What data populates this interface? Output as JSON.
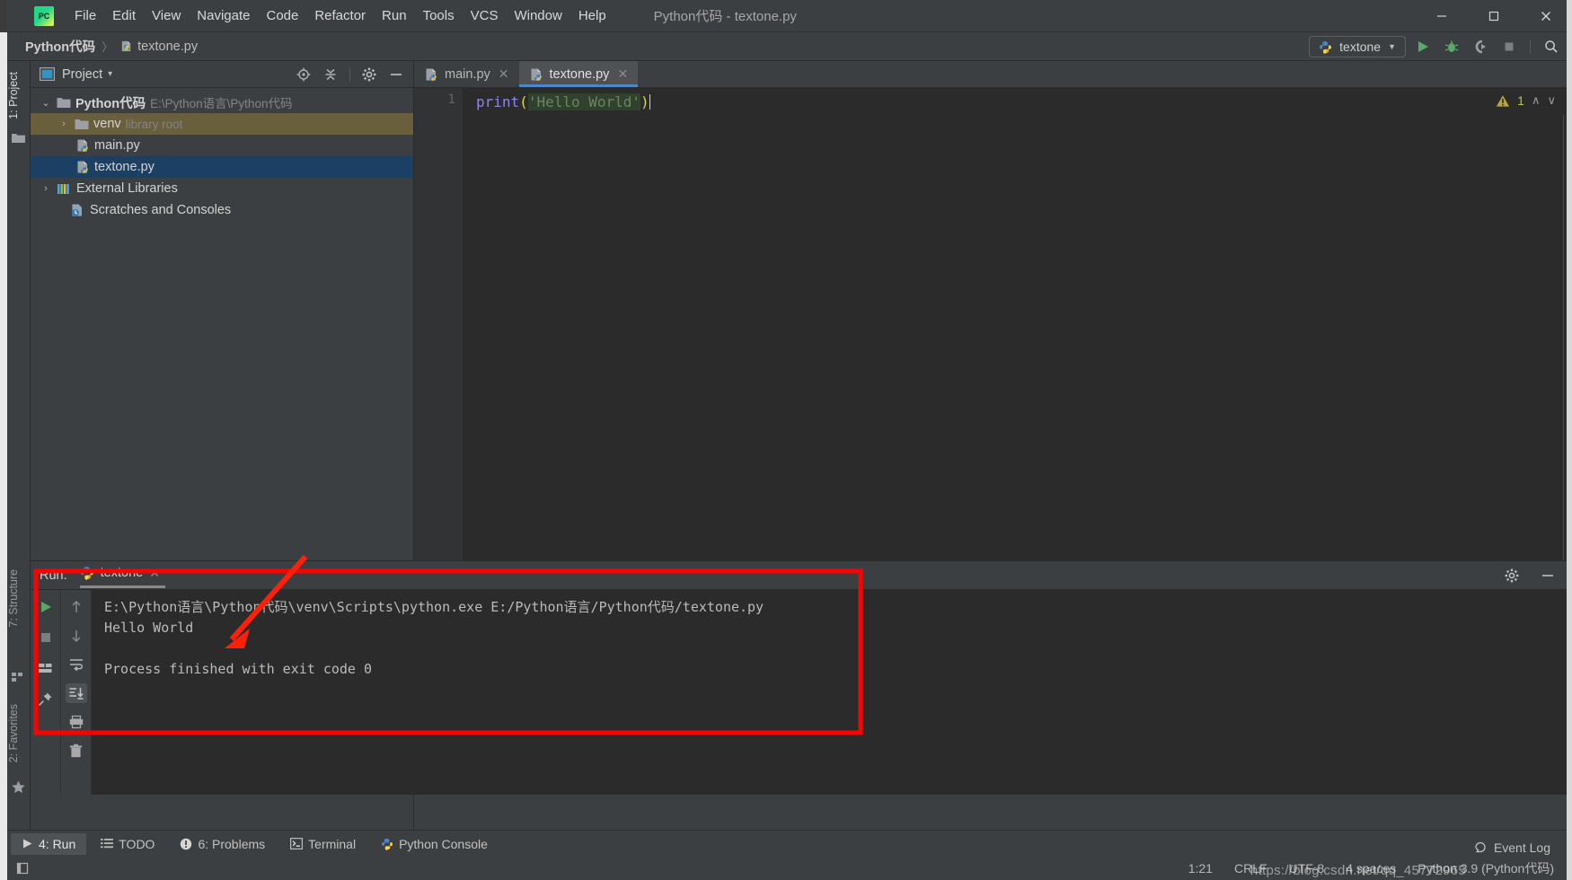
{
  "window": {
    "title": "Python代码 - textone.py",
    "minimize": "─",
    "maximize": "☐",
    "close": "✕"
  },
  "menu": {
    "items": [
      {
        "label": "File"
      },
      {
        "label": "Edit"
      },
      {
        "label": "View"
      },
      {
        "label": "Navigate"
      },
      {
        "label": "Code"
      },
      {
        "label": "Refactor"
      },
      {
        "label": "Run"
      },
      {
        "label": "Tools"
      },
      {
        "label": "VCS"
      },
      {
        "label": "Window"
      },
      {
        "label": "Help"
      }
    ]
  },
  "navbar": {
    "crumb_project": "Python代码",
    "crumb_sep": "〉",
    "crumb_file": "textone.py",
    "run_config": "textone",
    "run_config_caret": "▼"
  },
  "left_strip": {
    "project_tab": "1: Project",
    "structure_tab": "7: Structure",
    "favorites_tab": "2: Favorites"
  },
  "project_panel": {
    "title": "Project",
    "title_caret": "▾",
    "tree": [
      {
        "label": "Python代码",
        "sub": "E:\\Python语言\\Python代码",
        "arrow": "⌄",
        "type": "folder",
        "depth": 0,
        "state": "expanded"
      },
      {
        "label": "venv",
        "sub": "library root",
        "arrow": "›",
        "type": "folder",
        "depth": 1,
        "state": "highlight"
      },
      {
        "label": "main.py",
        "sub": "",
        "arrow": "",
        "type": "python",
        "depth": 2,
        "state": "normal"
      },
      {
        "label": "textone.py",
        "sub": "",
        "arrow": "",
        "type": "python",
        "depth": 2,
        "state": "selected"
      },
      {
        "label": "External Libraries",
        "sub": "",
        "arrow": "›",
        "type": "library",
        "depth": 0,
        "state": "normal"
      },
      {
        "label": "Scratches and Consoles",
        "sub": "",
        "arrow": "",
        "type": "scratch",
        "depth": 1,
        "state": "normal"
      }
    ]
  },
  "editor": {
    "tabs": [
      {
        "label": "main.py",
        "close": "✕",
        "active": false
      },
      {
        "label": "textone.py",
        "close": "✕",
        "active": true
      }
    ],
    "line_number": "1",
    "code": {
      "fn": "print",
      "paren_open": "(",
      "string": "'Hello World'",
      "paren_close": ")"
    },
    "inspection": {
      "warning_count": "1",
      "up": "∧",
      "down": "∨"
    }
  },
  "run_panel": {
    "label": "Run:",
    "tab_name": "textone",
    "tab_close": "✕",
    "console_lines": [
      "E:\\Python语言\\Python代码\\venv\\Scripts\\python.exe E:/Python语言/Python代码/textone.py",
      "Hello World",
      "",
      "Process finished with exit code 0"
    ],
    "toolbar_left": [
      "run-icon",
      "stop-icon",
      "layout-icon",
      "pin-icon"
    ],
    "toolbar_second": [
      "arrow-up-icon",
      "arrow-down-icon",
      "soft-wrap-icon",
      "scroll-to-end-icon",
      "print-icon",
      "trash-icon"
    ],
    "settings_icon": "gear-icon",
    "hide_icon": "─"
  },
  "bottom_tabs": [
    {
      "label": "4: Run",
      "icon": "play-icon",
      "active": true
    },
    {
      "label": "TODO",
      "icon": "list-icon",
      "active": false
    },
    {
      "label": "6: Problems",
      "icon": "warning-circle-icon",
      "active": false
    },
    {
      "label": "Terminal",
      "icon": "terminal-icon",
      "active": false
    },
    {
      "label": "Python Console",
      "icon": "python-icon",
      "active": false
    }
  ],
  "status_bar": {
    "caret_position": "1:21",
    "line_separator": "CRLF",
    "encoding": "UTF-8",
    "indent": "4 spaces",
    "interpreter": "Python 3.9 (Python代码)",
    "event_log": "Event Log"
  },
  "watermark": {
    "text": "https://blog.csdn.net/qq_45772965"
  },
  "colors": {
    "background": "#3c3f41",
    "editor_background": "#2b2b2b",
    "selection_blue": "#1c3f64",
    "highlight_olive": "#6a5f3c",
    "accent_tab": "#4a88c7",
    "annotation_red": "#ff0000",
    "string_green": "#6a8759",
    "keyword_purple": "#8a86ef",
    "run_green": "#59a869"
  }
}
